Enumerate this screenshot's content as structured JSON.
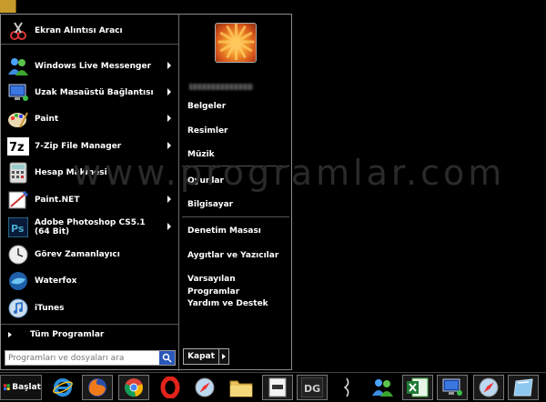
{
  "watermark": "www.programlar.com",
  "left_pane": {
    "pinned": {
      "label": "Ekran Alıntısı Aracı",
      "icon": "scissors-icon"
    },
    "programs": [
      {
        "label": "Windows Live Messenger",
        "icon": "messenger-icon",
        "has_arrow": true
      },
      {
        "label": "Uzak Masaüstü Bağlantısı",
        "icon": "remote-desktop-icon",
        "has_arrow": true
      },
      {
        "label": "Paint",
        "icon": "paint-icon",
        "has_arrow": true
      },
      {
        "label": "7-Zip File Manager",
        "icon": "7zip-icon",
        "has_arrow": true
      },
      {
        "label": "Hesap Makinesi",
        "icon": "calculator-icon",
        "has_arrow": false
      },
      {
        "label": "Paint.NET",
        "icon": "paintnet-icon",
        "has_arrow": true
      },
      {
        "label": "Adobe Photoshop CS5.1 (64 Bit)",
        "icon": "photoshop-icon",
        "has_arrow": true
      },
      {
        "label": "Görev Zamanlayıcı",
        "icon": "clock-icon",
        "has_arrow": false
      },
      {
        "label": "Waterfox",
        "icon": "waterfox-icon",
        "has_arrow": false
      },
      {
        "label": "iTunes",
        "icon": "itunes-icon",
        "has_arrow": false
      }
    ],
    "all_programs": "Tüm Programlar",
    "search_placeholder": "Programları ve dosyaları ara"
  },
  "right_pane": {
    "group1": [
      "Belgeler",
      "Resimler",
      "Müzik"
    ],
    "group2": [
      "Oyunlar",
      "Bilgisayar"
    ],
    "group3": [
      "Denetim Masası",
      "Aygıtlar ve Yazıcılar",
      "Varsayılan Programlar",
      "Yardım ve Destek"
    ],
    "shutdown_label": "Kapat"
  },
  "taskbar": {
    "start_label": "Başlat",
    "icons": [
      "ie-icon",
      "firefox-icon",
      "chrome-icon",
      "opera-icon",
      "safari-icon",
      "folder-icon",
      "notepad-icon",
      "dg-icon",
      "pen-icon",
      "messenger-icon",
      "excel-icon",
      "remote-desktop-icon",
      "safari-icon",
      "window-icon"
    ]
  }
}
